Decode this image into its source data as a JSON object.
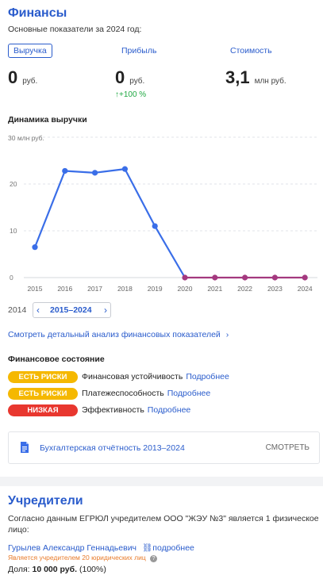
{
  "finances": {
    "title": "Финансы",
    "subtitle": "Основные показатели за 2024 год:",
    "tabs": [
      {
        "label": "Выручка",
        "active": true
      },
      {
        "label": "Прибыль",
        "active": false
      },
      {
        "label": "Стоимость",
        "active": false
      }
    ],
    "metrics": [
      {
        "value": "0",
        "unit": "руб."
      },
      {
        "value": "0",
        "unit": "руб.",
        "change": "↑+100 %"
      },
      {
        "value": "3,1",
        "unit": "млн руб."
      }
    ],
    "chart_section_title": "Динамика выручки"
  },
  "chart_data": {
    "type": "line",
    "title": "",
    "x": [
      "2015",
      "2016",
      "2017",
      "2018",
      "2019",
      "2020",
      "2021",
      "2022",
      "2023",
      "2024"
    ],
    "values": [
      6.5,
      22.8,
      22.4,
      23.2,
      11,
      0,
      0,
      0,
      0,
      0
    ],
    "y_unit_label": "30 млн руб.",
    "y_ticks": [
      "20",
      "10",
      "0"
    ],
    "ylim": [
      0,
      30
    ],
    "grid": "horizontal-dashed",
    "colors": {
      "line": "#3a6ee8",
      "zero_line": "#a4397f"
    }
  },
  "year_range": {
    "prev_label": "2014",
    "current_label": "2015–2024",
    "prev_icon": "chevron-left-icon",
    "next_icon": "chevron-right-icon"
  },
  "analysis_link": "Смотреть детальный анализ финансовых показателей",
  "state": {
    "title": "Финансовое состояние",
    "items": [
      {
        "badge": "ЕСТЬ РИСКИ",
        "color": "#f5b800",
        "label": "Финансовая устойчивость",
        "more": "Подробнее"
      },
      {
        "badge": "ЕСТЬ РИСКИ",
        "color": "#f5b800",
        "label": "Платежеспособность",
        "more": "Подробнее"
      },
      {
        "badge": "НИЗКАЯ",
        "color": "#e8372f",
        "label": "Эффективность",
        "more": "Подробнее"
      }
    ]
  },
  "report": {
    "label": "Бухгалтерская отчётность 2013–2024",
    "action": "СМОТРЕТЬ",
    "icon": "document-icon"
  },
  "owners": {
    "title": "Учредители",
    "text_line1": "Согласно данным ЕГРЮЛ учредителем ООО \"ЖЭУ №3\" является 1 физическое",
    "text_line2": "лицо:",
    "person_name": "Гурылев Александр Геннадьевич",
    "person_link": "подробнее",
    "person_note": "Является учредителем 20 юридических лиц",
    "share_label": "Доля:",
    "share_value": "10 000 руб.",
    "share_pct": "(100%)"
  },
  "colors": {
    "accent": "#2a5ccc",
    "success": "#1fa842",
    "warning": "#f5b800",
    "danger": "#e8372f",
    "note": "#e87b2a"
  }
}
